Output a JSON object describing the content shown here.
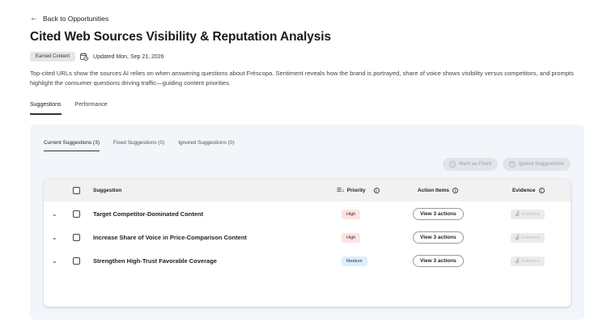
{
  "nav": {
    "back_label": "Back to Opportunities"
  },
  "page": {
    "title": "Cited Web Sources Visibility & Reputation Analysis",
    "badge": "Earned Content",
    "updated": "Updated Mon, Sep 21, 2026",
    "description": "Top-cited URLs show the sources AI relies on when answering questions about Fréscopa. Sentiment reveals how the brand is portrayed, share of voice shows visibility versus competitors, and prompts highlight the consumer questions driving traffic—guiding content priorities."
  },
  "tabs": [
    {
      "label": "Suggestions",
      "active": true
    },
    {
      "label": "Performance",
      "active": false
    }
  ],
  "subtabs": [
    {
      "label": "Current Suggestions (3)",
      "active": true
    },
    {
      "label": "Fixed Suggestions (0)",
      "active": false
    },
    {
      "label": "Ignored Suggestions (0)",
      "active": false
    }
  ],
  "actions": {
    "mark_fixed": "Mark as Fixed",
    "ignore": "Ignore Suggestions"
  },
  "table": {
    "headers": {
      "suggestion": "Suggestion",
      "priority": "Priority",
      "action_items": "Action Items",
      "evidence": "Evidence"
    },
    "rows": [
      {
        "suggestion": "Target Competitor-Dominated Content",
        "priority": "High",
        "action": "View 3 actions",
        "evidence": "Evidence"
      },
      {
        "suggestion": "Increase Share of Voice in Price-Comparison Content",
        "priority": "High",
        "action": "View 3 actions",
        "evidence": "Evidence"
      },
      {
        "suggestion": "Strengthen High-Trust Favorable Coverage",
        "priority": "Medium",
        "action": "View 3 actions",
        "evidence": "Evidence"
      }
    ]
  },
  "colors": {
    "panel_bg": "#f2f5fa",
    "priority_high_bg": "#fde3e0",
    "priority_medium_bg": "#ddeefe"
  }
}
